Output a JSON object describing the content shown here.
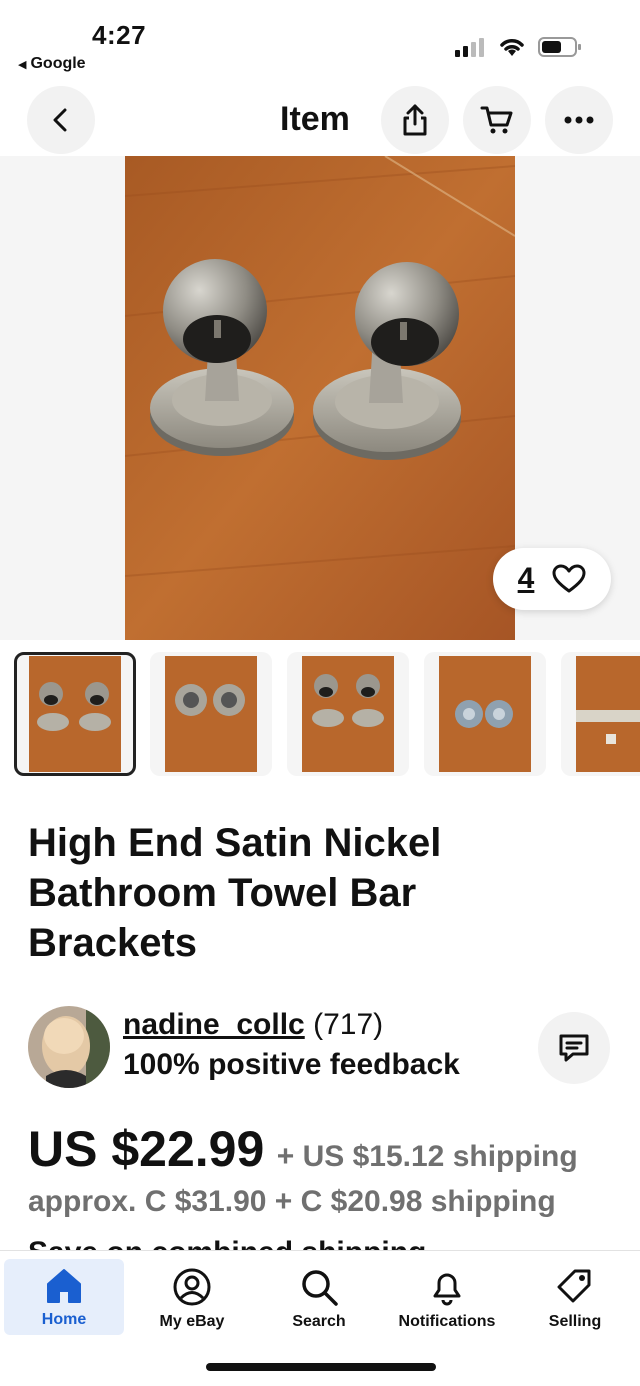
{
  "status_bar": {
    "time": "4:27",
    "back_app_label": "Google"
  },
  "nav": {
    "title": "Item",
    "back_icon": "chevron-left-icon",
    "share_icon": "share-icon",
    "cart_icon": "cart-icon",
    "more_icon": "more-horizontal-icon"
  },
  "gallery": {
    "watch_count": "4",
    "thumbnail_count": 5,
    "selected_index": 0
  },
  "item": {
    "title": "High End Satin Nickel Bathroom Towel Bar Brackets"
  },
  "seller": {
    "name": "nadine_collc",
    "rating_count": "(717)",
    "feedback": "100% positive feedback"
  },
  "pricing": {
    "price": "US $22.99",
    "shipping": "+ US $15.12 shipping",
    "approx": "approx. C $31.90 + C $20.98 shipping",
    "combined": "Save on combined shipping"
  },
  "tab_bar": {
    "tabs": [
      {
        "label": "Home",
        "icon": "home-icon",
        "active": true
      },
      {
        "label": "My eBay",
        "icon": "user-icon",
        "active": false
      },
      {
        "label": "Search",
        "icon": "search-icon",
        "active": false
      },
      {
        "label": "Notifications",
        "icon": "bell-icon",
        "active": false
      },
      {
        "label": "Selling",
        "icon": "tag-icon",
        "active": false
      }
    ]
  },
  "colors": {
    "accent": "#1a5fd0",
    "secondary_text": "#707070",
    "wood": "#b5652a"
  }
}
